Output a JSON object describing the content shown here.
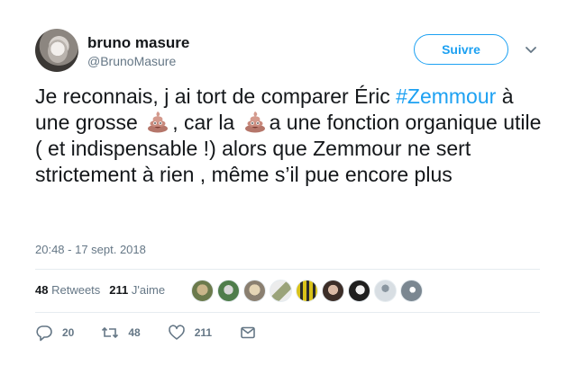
{
  "user": {
    "display_name": "bruno masure",
    "handle": "@BrunoMasure",
    "avatar_icon": "user-avatar"
  },
  "follow_button": {
    "label": "Suivre",
    "color": "#1da1f2"
  },
  "tweet": {
    "part1": "Je reconnais, j ai tort de comparer Éric ",
    "hashtag": "#Zemmour",
    "part2": " à une grosse ",
    "part3": ", car la ",
    "part4": "a une fonction organique utile ( et indispensable !) alors que Zemmour ne sert strictement à rien , même s’il pue encore plus",
    "emoji_icon": "pile-of-poo-emoji"
  },
  "timestamp": "20:48 - 17 sept. 2018",
  "stats": {
    "retweets_count": "48",
    "retweets_label": "Retweets",
    "likes_count": "211",
    "likes_label": "J'aime"
  },
  "liker_avatars_count": 9,
  "actions": {
    "reply_count": "20",
    "retweet_count": "48",
    "like_count": "211",
    "reply_icon": "reply-icon",
    "retweet_icon": "retweet-icon",
    "like_icon": "heart-icon",
    "message_icon": "envelope-icon"
  },
  "colors": {
    "accent": "#1da1f2",
    "muted": "#657786",
    "text": "#14171a"
  }
}
